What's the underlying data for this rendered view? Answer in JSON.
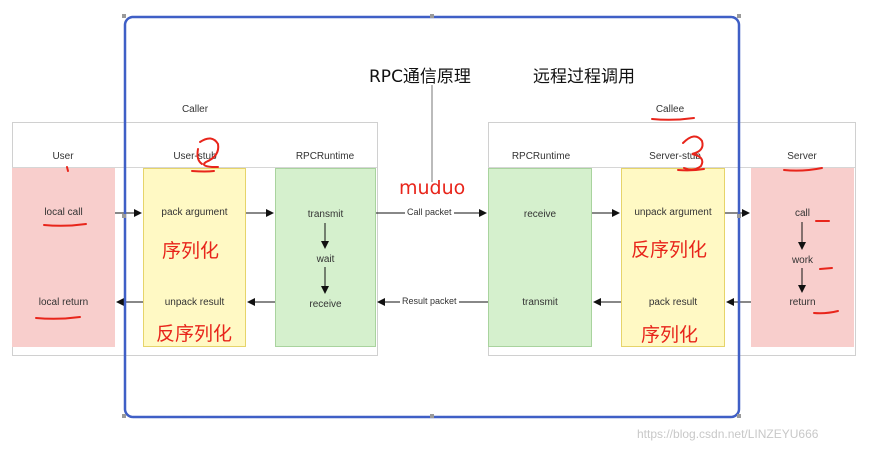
{
  "title": "RPC通信原理",
  "subtitle": "远程过程调用",
  "framework_note": "muduo",
  "watermark": "https://blog.csdn.net/LINZEYU666",
  "colors": {
    "client_server": "#f8cecc",
    "stub": "#fff9c4",
    "runtime": "#d5f0cd",
    "annotation_red": "#e8251b",
    "selection_blue": "#3f5fc6"
  },
  "groups": {
    "caller": "Caller",
    "callee": "Callee"
  },
  "columns": {
    "user": {
      "label": "User",
      "top_item": "local call",
      "bottom_item": "local return"
    },
    "user_stub": {
      "label": "User-stub",
      "top_item": "pack argument",
      "top_note": "序列化",
      "bottom_item": "unpack result",
      "bottom_note": "反序列化"
    },
    "caller_runtime": {
      "label": "RPCRuntime",
      "steps": [
        "transmit",
        "wait",
        "receive"
      ]
    },
    "callee_runtime": {
      "label": "RPCRuntime",
      "top_item": "receive",
      "bottom_item": "transmit"
    },
    "server_stub": {
      "label": "Server-stub",
      "top_item": "unpack argument",
      "top_note": "反序列化",
      "bottom_item": "pack result",
      "bottom_note": "序列化"
    },
    "server": {
      "label": "Server",
      "steps": [
        "call",
        "work",
        "return"
      ]
    }
  },
  "links": {
    "call_packet": "Call packet",
    "result_packet": "Result packet"
  }
}
